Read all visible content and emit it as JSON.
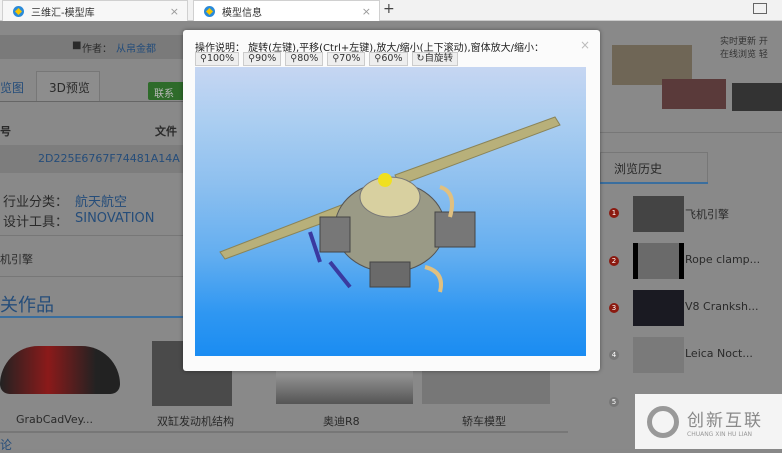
{
  "browser": {
    "tabs": [
      {
        "label": "三维汇-模型库"
      },
      {
        "label": "模型信息"
      }
    ],
    "new_tab": "+",
    "close": "×"
  },
  "page": {
    "author_label": "作者：",
    "author": "从帛金都",
    "tabs": [
      "览图",
      "3D预览"
    ],
    "contact_button": "联系",
    "file_label": "文件",
    "code_label": "号",
    "model_id": "2D225E6767F74481A14A",
    "industry_label": "行业分类：",
    "industry": "航天航空",
    "tool_label": "设计工具：",
    "tool": "SINOVATION",
    "model_name": "机引擎",
    "related_title": "关作品",
    "related": [
      {
        "name": "GrabCadVey..."
      },
      {
        "name": "双缸发动机结构"
      },
      {
        "name": "奥迪R8"
      },
      {
        "name": "轿车模型"
      }
    ],
    "comments_title": "论",
    "banner_lines": [
      "实时更新  开",
      "在线浏览  轻"
    ],
    "history_title": "浏览历史",
    "history": [
      {
        "n": "1",
        "name": "飞机引擎"
      },
      {
        "n": "2",
        "name": "Rope clamp..."
      },
      {
        "n": "3",
        "name": "V8 Cranksh..."
      },
      {
        "n": "4",
        "name": "Leica Noct..."
      },
      {
        "n": "5",
        "name": ""
      }
    ],
    "watermark": {
      "title": "创新互联",
      "sub": "CHUANG XIN HU LIAN"
    }
  },
  "modal": {
    "instructions": "操作说明： 旋转(左键),平移(Ctrl+左键),放大/缩小(上下滚动),窗体放大/缩小：",
    "close": "×",
    "zoom_buttons": [
      "100%",
      "90%",
      "80%",
      "70%",
      "60%"
    ],
    "auto_rotate": "自旋转"
  },
  "colors": {
    "accent": "#1a8cf2",
    "link": "#254d7a"
  }
}
